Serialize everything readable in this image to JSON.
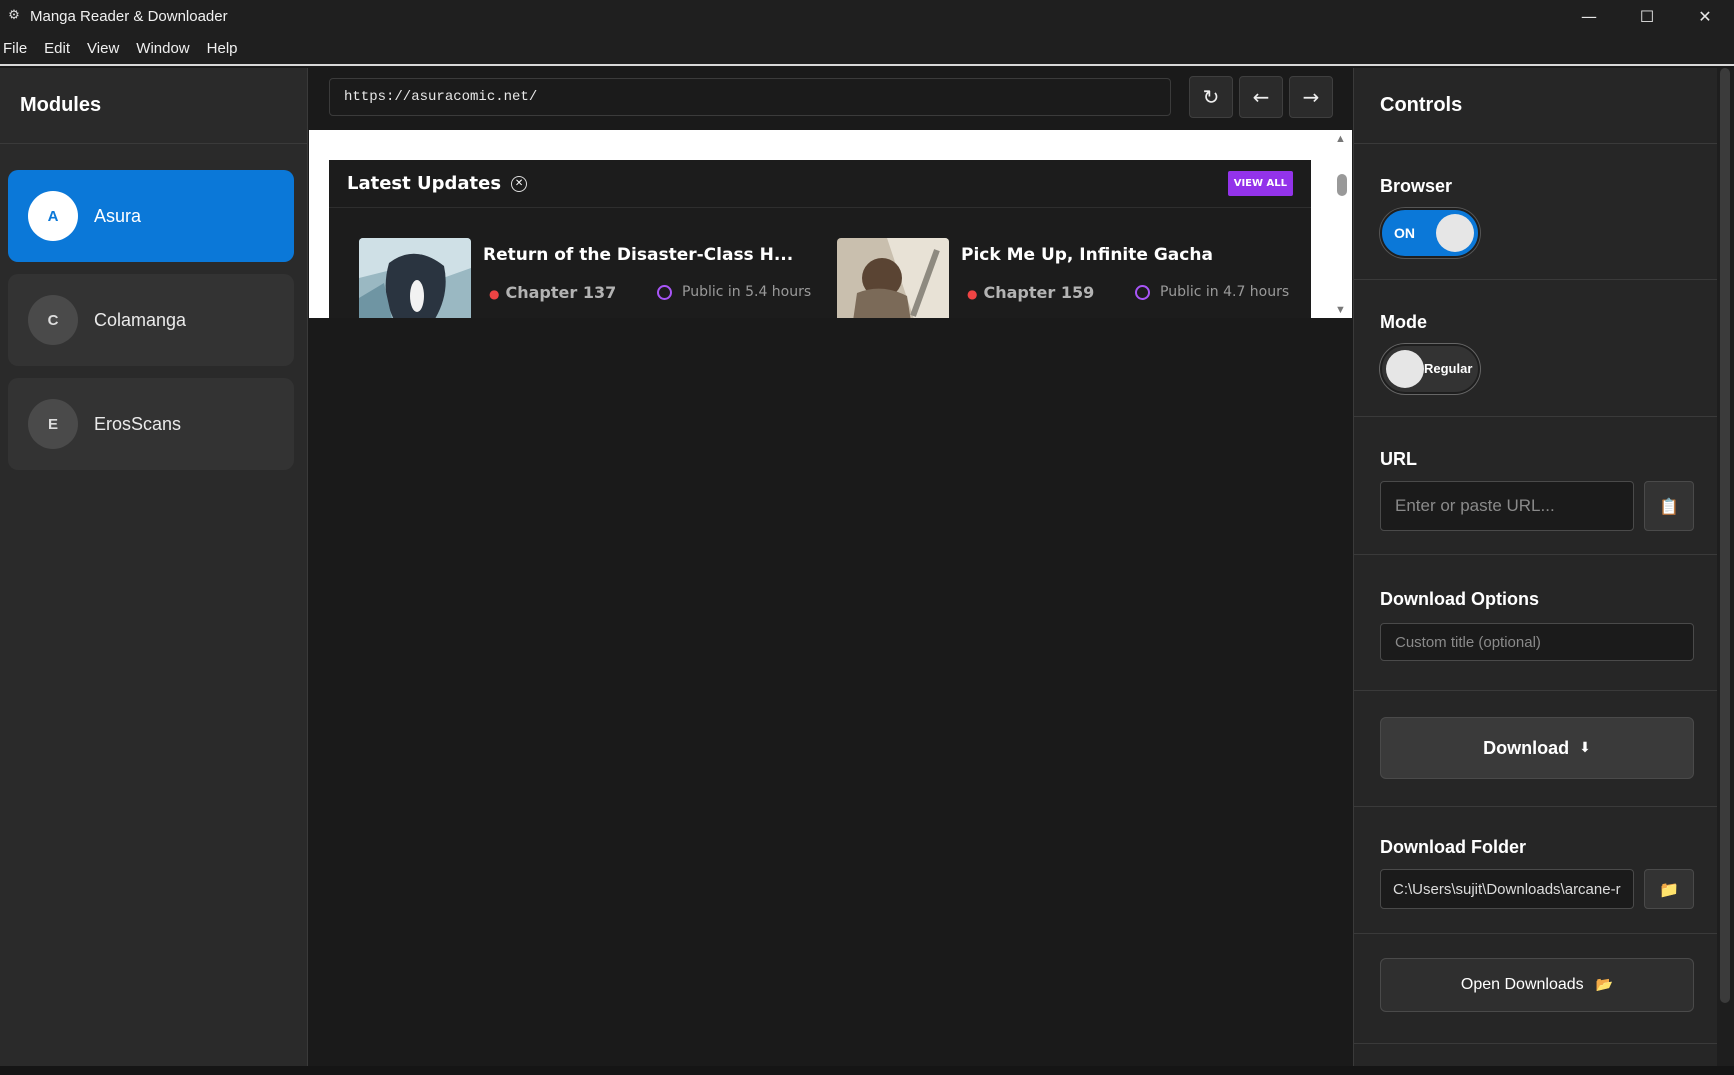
{
  "window": {
    "title": "Manga Reader & Downloader",
    "icon": "gear-icon",
    "controls": {
      "minimize": "—",
      "maximize": "☐",
      "close": "✕"
    }
  },
  "menu": [
    "File",
    "Edit",
    "View",
    "Window",
    "Help"
  ],
  "sidebar": {
    "title": "Modules",
    "modules": [
      {
        "initial": "A",
        "label": "Asura",
        "active": true
      },
      {
        "initial": "C",
        "label": "Colamanga",
        "active": false
      },
      {
        "initial": "E",
        "label": "ErosScans",
        "active": false
      }
    ]
  },
  "browser": {
    "url": "https://asuracomic.net/",
    "refresh": "↻",
    "back": "←",
    "forward": "→"
  },
  "webpage": {
    "section_title": "Latest Updates",
    "view_all": "VIEW ALL",
    "cards": [
      {
        "title": "Return of the Disaster-Class H...",
        "chapter": "Chapter 137",
        "public": "Public in 5.4 hours"
      },
      {
        "title": "Pick Me Up, Infinite Gacha",
        "chapter": "Chapter 159",
        "public": "Public in 4.7 hours"
      }
    ]
  },
  "controls": {
    "title": "Controls",
    "browser_label": "Browser",
    "browser_toggle": "ON",
    "mode_label": "Mode",
    "mode_toggle": "Regular",
    "url_label": "URL",
    "url_placeholder": "Enter or paste URL...",
    "paste_icon": "📋",
    "download_options_label": "Download Options",
    "custom_title_placeholder": "Custom title (optional)",
    "download_button": "Download",
    "download_icon": "⬇",
    "download_folder_label": "Download Folder",
    "download_folder_value": "C:\\Users\\sujit\\Downloads\\arcane-r",
    "folder_icon": "📁",
    "open_downloads_button": "Open Downloads",
    "open_downloads_icon": "📂"
  },
  "colors": {
    "accent": "#0b78d8",
    "view_all": "#9333ea",
    "chapter_dot": "#ef4444"
  }
}
